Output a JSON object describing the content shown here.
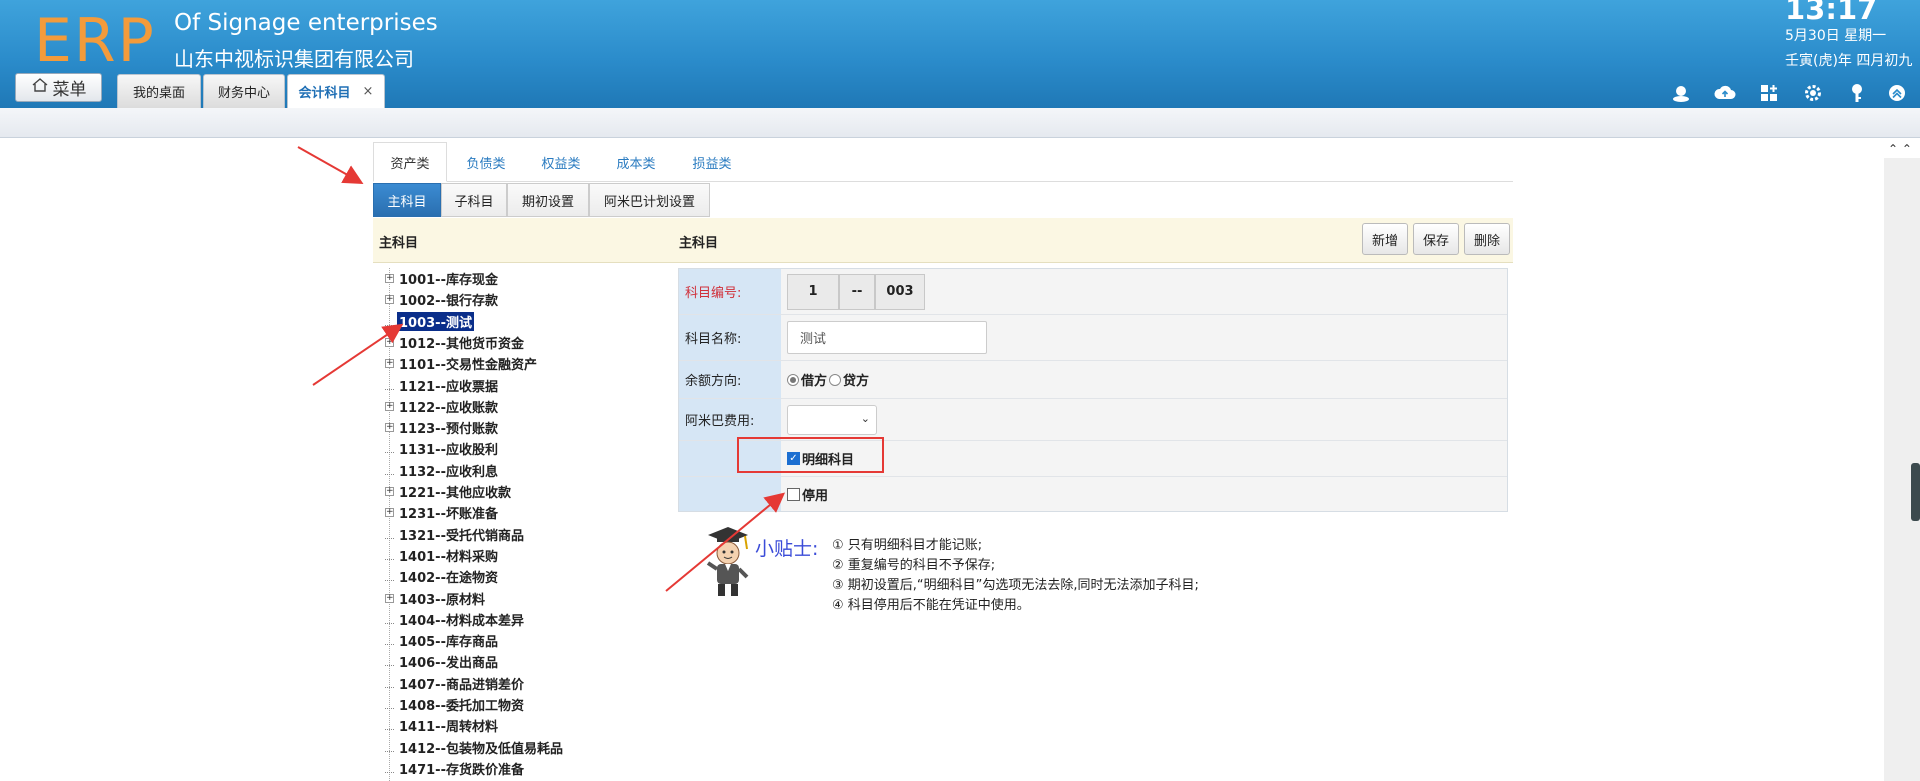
{
  "header": {
    "logo": "ERP",
    "brand_en": "Of Signage enterprises",
    "brand_cn": "山东中视标识集团有限公司",
    "time": "13:17",
    "date": "5月30日 星期一",
    "lunar": "壬寅(虎)年 四月初九",
    "menu_label": "菜单",
    "tabs": [
      {
        "label": "我的桌面"
      },
      {
        "label": "财务中心"
      },
      {
        "label": "会计科目",
        "close": "×",
        "active": true
      }
    ],
    "icons": [
      "user-icon",
      "cloud-icon",
      "apps-icon",
      "gear-icon",
      "key-icon",
      "collapse-icon"
    ]
  },
  "category_tabs": [
    "资产类",
    "负债类",
    "权益类",
    "成本类",
    "损益类"
  ],
  "sub_tabs": [
    "主科目",
    "子科目",
    "期初设置",
    "阿米巴计划设置"
  ],
  "section": {
    "tree_title": "主科目",
    "form_title": "主科目",
    "buttons": [
      "新增",
      "保存",
      "删除"
    ]
  },
  "tree": [
    {
      "label": "1001--库存现金",
      "expandable": true
    },
    {
      "label": "1002--银行存款",
      "expandable": true
    },
    {
      "label": "1003--测试",
      "selected": true
    },
    {
      "label": "1012--其他货币资金",
      "expandable": true
    },
    {
      "label": "1101--交易性金融资产",
      "expandable": true
    },
    {
      "label": "1121--应收票据"
    },
    {
      "label": "1122--应收账款",
      "expandable": true
    },
    {
      "label": "1123--预付账款",
      "expandable": true
    },
    {
      "label": "1131--应收股利"
    },
    {
      "label": "1132--应收利息"
    },
    {
      "label": "1221--其他应收款",
      "expandable": true
    },
    {
      "label": "1231--坏账准备",
      "expandable": true
    },
    {
      "label": "1321--受托代销商品"
    },
    {
      "label": "1401--材料采购"
    },
    {
      "label": "1402--在途物资"
    },
    {
      "label": "1403--原材料",
      "expandable": true
    },
    {
      "label": "1404--材料成本差异"
    },
    {
      "label": "1405--库存商品"
    },
    {
      "label": "1406--发出商品"
    },
    {
      "label": "1407--商品进销差价"
    },
    {
      "label": "1408--委托加工物资"
    },
    {
      "label": "1411--周转材料"
    },
    {
      "label": "1412--包装物及低值易耗品"
    },
    {
      "label": "1471--存货跌价准备"
    }
  ],
  "form": {
    "code_label": "科目编号:",
    "code_parts": [
      "1",
      "--",
      "003"
    ],
    "name_label": "科目名称:",
    "name_value": "测试",
    "direction_label": "余额方向:",
    "debit": "借方",
    "credit": "贷方",
    "amiba_label": "阿米巴费用:",
    "detail_label": "明细科目",
    "disable_label": "停用"
  },
  "tips": {
    "title": "小贴士:",
    "items": [
      "① 只有明细科目才能记账;",
      "② 重复编号的科目不予保存;",
      "③ 期初设置后,“明细科目”勾选项无法去除,同时无法添加子科目;",
      "④ 科目停用后不能在凭证中使用。"
    ]
  },
  "colors": {
    "header_blue": "#2b8ccb",
    "logo_orange": "#f39b3b",
    "highlight_red": "#e53935",
    "selected_node": "#0a2e8a"
  }
}
